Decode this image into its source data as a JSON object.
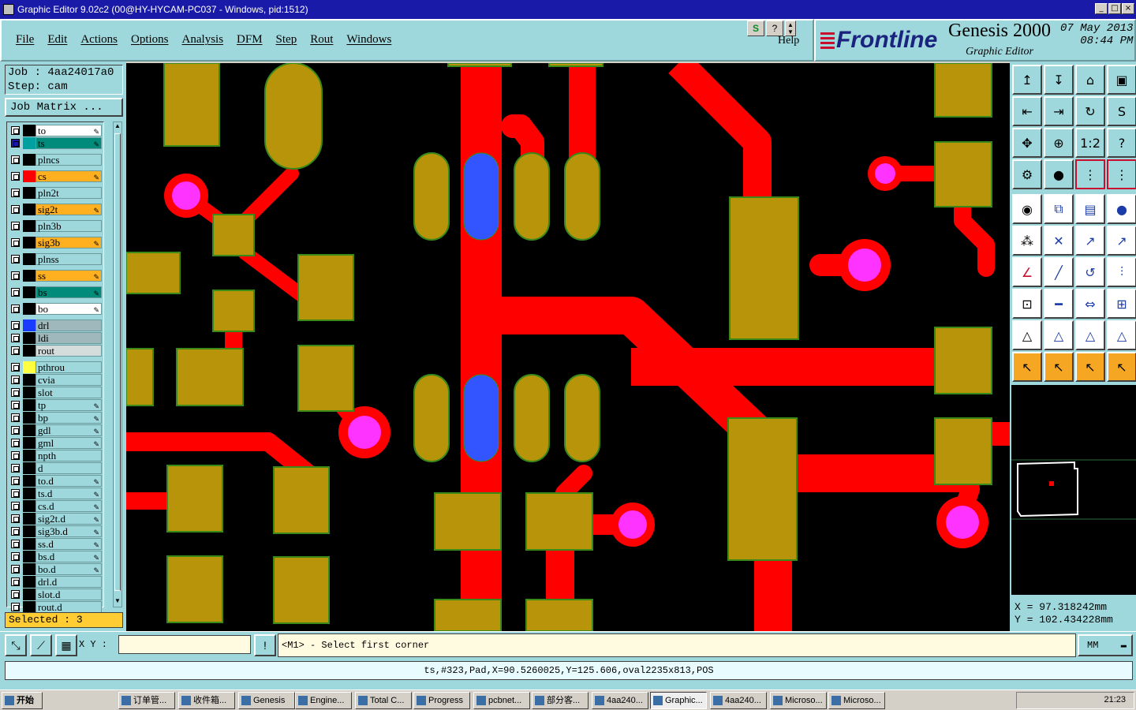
{
  "window": {
    "title": "Graphic Editor 9.02c2 (00@HY-HYCAM-PC037 - Windows, pid:1512)",
    "controls": [
      "_",
      "□",
      "×"
    ]
  },
  "menu": {
    "items": [
      "File",
      "Edit",
      "Actions",
      "Options",
      "Analysis",
      "DFM",
      "Step",
      "Rout",
      "Windows"
    ],
    "help_label": "Help"
  },
  "brand": {
    "logo": "Frontline",
    "product": "Genesis 2000",
    "subtitle": "Graphic Editor",
    "date": "07 May 2013",
    "time": "08:44 PM"
  },
  "job": {
    "job_line": "Job : 4aa24017a0",
    "step_line": "Step: cam",
    "matrix_button": "Job Matrix ..."
  },
  "layers": [
    {
      "name": "to",
      "swatch": "#000000",
      "bg": "#ffffff",
      "pen": true
    },
    {
      "name": "ts",
      "swatch": "#00a0a0",
      "bg": "#008b7a",
      "pen": true,
      "active": true
    },
    {
      "name": "plncs",
      "swatch": "#000000",
      "bg": "#9fd8dc",
      "pen": false
    },
    {
      "name": "cs",
      "swatch": "#ff0000",
      "bg": "#ffb020",
      "pen": true
    },
    {
      "name": "pln2t",
      "swatch": "#000000",
      "bg": "#9fd8dc",
      "pen": false
    },
    {
      "name": "sig2t",
      "swatch": "#000000",
      "bg": "#ffb020",
      "pen": true
    },
    {
      "name": "pln3b",
      "swatch": "#000000",
      "bg": "#9fd8dc",
      "pen": false
    },
    {
      "name": "sig3b",
      "swatch": "#000000",
      "bg": "#ffb020",
      "pen": true
    },
    {
      "name": "plnss",
      "swatch": "#000000",
      "bg": "#9fd8dc",
      "pen": false
    },
    {
      "name": "ss",
      "swatch": "#000000",
      "bg": "#ffb020",
      "pen": true
    },
    {
      "name": "bs",
      "swatch": "#000000",
      "bg": "#008b7a",
      "pen": true
    },
    {
      "name": "bo",
      "swatch": "#000000",
      "bg": "#ffffff",
      "pen": true
    },
    {
      "name": "drl",
      "swatch": "#1a3cff",
      "bg": "#9fb8bc",
      "pen": false
    },
    {
      "name": "ldi",
      "swatch": "#000000",
      "bg": "#9fb8bc",
      "pen": false
    },
    {
      "name": "rout",
      "swatch": "#000000",
      "bg": "#d4dcdc",
      "pen": false
    },
    {
      "name": "pthrou",
      "swatch": "#ffff40",
      "bg": "#9fd8dc",
      "pen": false
    },
    {
      "name": "cvia",
      "swatch": "#000000",
      "bg": "#9fd8dc",
      "pen": false
    },
    {
      "name": "slot",
      "swatch": "#000000",
      "bg": "#9fd8dc",
      "pen": false
    },
    {
      "name": "tp",
      "swatch": "#000000",
      "bg": "#9fd8dc",
      "pen": true
    },
    {
      "name": "bp",
      "swatch": "#000000",
      "bg": "#9fd8dc",
      "pen": true
    },
    {
      "name": "gdl",
      "swatch": "#000000",
      "bg": "#9fd8dc",
      "pen": true
    },
    {
      "name": "gml",
      "swatch": "#000000",
      "bg": "#9fd8dc",
      "pen": true
    },
    {
      "name": "npth",
      "swatch": "#000000",
      "bg": "#9fd8dc",
      "pen": false
    },
    {
      "name": "d",
      "swatch": "#000000",
      "bg": "#9fd8dc",
      "pen": false
    },
    {
      "name": "to.d",
      "swatch": "#000000",
      "bg": "#9fd8dc",
      "pen": true
    },
    {
      "name": "ts.d",
      "swatch": "#000000",
      "bg": "#9fd8dc",
      "pen": true
    },
    {
      "name": "cs.d",
      "swatch": "#000000",
      "bg": "#9fd8dc",
      "pen": true
    },
    {
      "name": "sig2t.d",
      "swatch": "#000000",
      "bg": "#9fd8dc",
      "pen": true
    },
    {
      "name": "sig3b.d",
      "swatch": "#000000",
      "bg": "#9fd8dc",
      "pen": true
    },
    {
      "name": "ss.d",
      "swatch": "#000000",
      "bg": "#9fd8dc",
      "pen": true
    },
    {
      "name": "bs.d",
      "swatch": "#000000",
      "bg": "#9fd8dc",
      "pen": true
    },
    {
      "name": "bo.d",
      "swatch": "#000000",
      "bg": "#9fd8dc",
      "pen": true
    },
    {
      "name": "drl.d",
      "swatch": "#000000",
      "bg": "#9fd8dc",
      "pen": false
    },
    {
      "name": "slot.d",
      "swatch": "#000000",
      "bg": "#9fd8dc",
      "pen": false
    },
    {
      "name": "rout.d",
      "swatch": "#000000",
      "bg": "#9fd8dc",
      "pen": false
    }
  ],
  "selected_text": "Selected : 3",
  "colors": {
    "pad": "#b8940a",
    "pad_outline": "#3a8a1a",
    "trace": "#ff0000",
    "drill": "#ff33ff",
    "slot": "#3355ff",
    "panel": "#9fd8dc"
  },
  "coordinates": {
    "x_line": "X = 97.318242mm",
    "y_line": "Y = 102.434228mm"
  },
  "command": {
    "xy_label": "X Y :",
    "xy_value": "",
    "prompt": "<M1> - Select first corner",
    "units": "MM"
  },
  "info_line": "ts,#323,Pad,X=90.5260025,Y=125.606,oval2235x813,POS",
  "taskbar": {
    "start": "开始",
    "tasks": [
      "订单管...",
      "收件箱...",
      "Genesis",
      "Engine...",
      "Total C...",
      "Progress",
      "pcbnet...",
      "部分客...",
      "4aa240...",
      "Graphic...",
      "4aa240...",
      "Microso...",
      "Microso..."
    ],
    "clock": "21:23"
  }
}
